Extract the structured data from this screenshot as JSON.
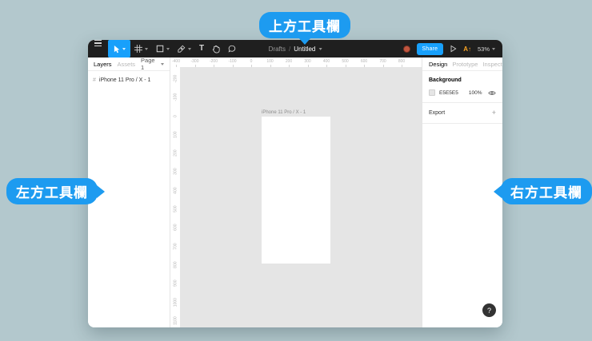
{
  "annotations": {
    "top": "上方工具欄",
    "left": "左方工具欄",
    "right": "右方工具欄"
  },
  "toolbar": {
    "breadcrumb": {
      "folder": "Drafts",
      "separator": "/",
      "title": "Untitled"
    },
    "share_label": "Share",
    "upgrade_badge": "A↑",
    "zoom_level": "53%",
    "icons": [
      "menu-icon",
      "move-tool-icon",
      "frame-tool-icon",
      "shape-tool-icon",
      "pen-tool-icon",
      "text-tool-icon",
      "hand-tool-icon",
      "comment-tool-icon",
      "avatar",
      "present-icon"
    ]
  },
  "left_panel": {
    "tabs": [
      "Layers",
      "Assets"
    ],
    "page_selector": "Page 1",
    "layers": [
      {
        "name": "iPhone 11 Pro / X - 1"
      }
    ]
  },
  "canvas": {
    "h_ruler": [
      "-400",
      "-300",
      "-200",
      "-100",
      "0",
      "100",
      "200",
      "300",
      "400",
      "500",
      "600",
      "700",
      "800"
    ],
    "v_ruler": [
      "-200",
      "-100",
      "0",
      "100",
      "200",
      "300",
      "400",
      "500",
      "600",
      "700",
      "800",
      "900",
      "1000",
      "1100"
    ],
    "frame_label": "iPhone 11 Pro / X - 1"
  },
  "right_panel": {
    "tabs": [
      "Design",
      "Prototype",
      "Inspect"
    ],
    "background_section": {
      "title": "Background",
      "color_hex": "E5E5E5",
      "opacity": "100%"
    },
    "export_section": {
      "title": "Export",
      "add_label": "+"
    },
    "help_label": "?"
  },
  "colors": {
    "page_bg": "#b3c8cd",
    "annotation_blue": "#1d9bf0",
    "accent_blue": "#18a0fb",
    "toolbar_bg": "#1f1f1f",
    "canvas_bg": "#e5e5e5",
    "badge_orange": "#f7a325"
  }
}
